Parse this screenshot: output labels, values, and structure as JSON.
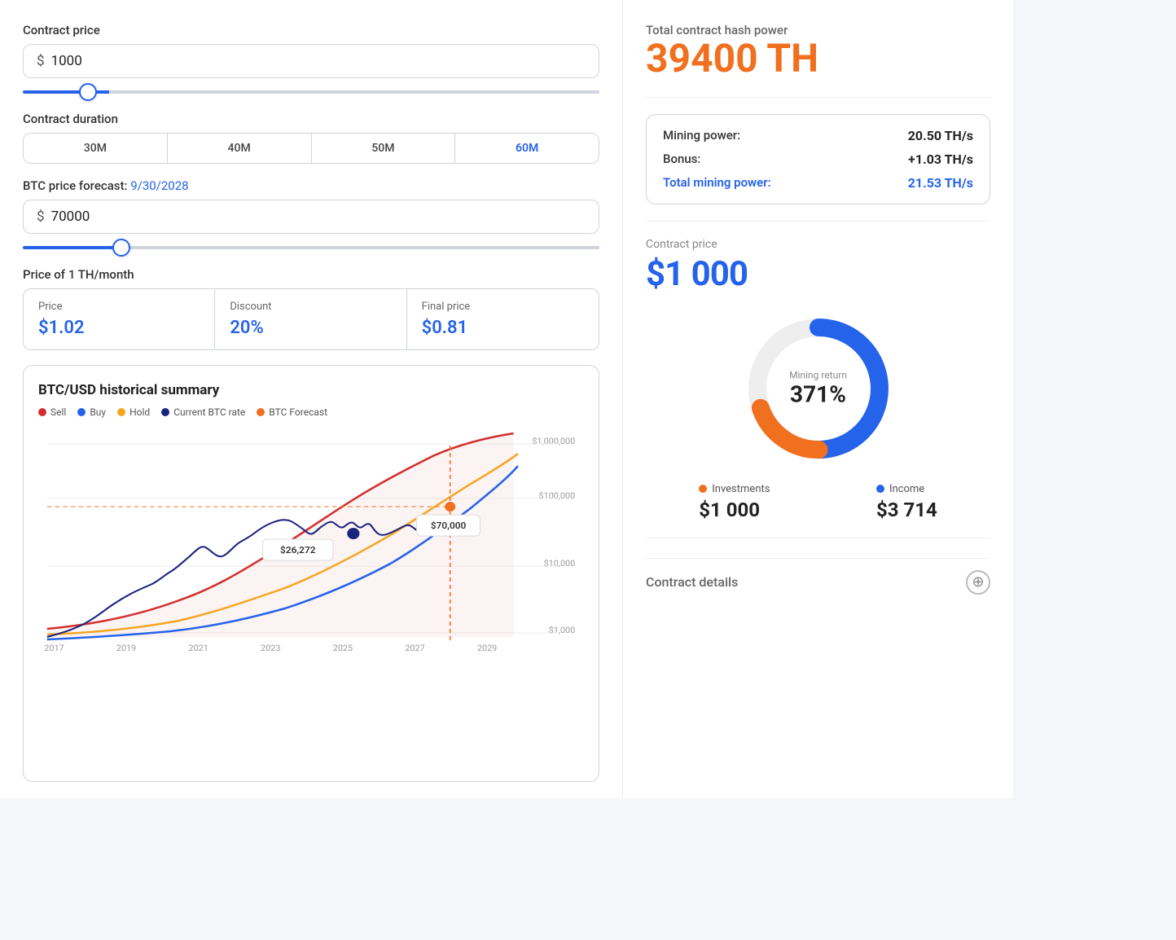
{
  "left": {
    "contract_price_label": "Contract price",
    "contract_price_value": "1000",
    "currency_symbol": "$",
    "slider1_value": 10,
    "contract_duration_label": "Contract duration",
    "duration_tabs": [
      "30M",
      "40M",
      "50M",
      "60M"
    ],
    "active_tab": "60M",
    "forecast_label": "BTC price forecast:",
    "forecast_date": "9/30/2028",
    "btc_price_value": "70000",
    "slider2_value": 16,
    "th_price_label": "Price of 1 TH/month",
    "th_cells": [
      {
        "label": "Price",
        "value": "$1.02"
      },
      {
        "label": "Discount",
        "value": "20%"
      },
      {
        "label": "Final price",
        "value": "$0.81"
      }
    ],
    "chart_title": "BTC/USD historical summary",
    "chart_legend": [
      {
        "color": "#d32f2f",
        "label": "Sell"
      },
      {
        "color": "#2563eb",
        "label": "Buy"
      },
      {
        "color": "#f5a623",
        "label": "Hold"
      },
      {
        "color": "#1a237e",
        "label": "Current BTC rate"
      },
      {
        "color": "#f07020",
        "label": "BTC Forecast"
      }
    ],
    "chart_x_labels": [
      "2017",
      "2019",
      "2021",
      "2023",
      "2025",
      "2027",
      "2029"
    ],
    "chart_y_labels": [
      "$1,000,000",
      "$100,000",
      "$10,000",
      "$1,000"
    ],
    "tooltip1_value": "$26,272",
    "tooltip2_value": "$70,000"
  },
  "right": {
    "total_hash_label": "Total contract hash power",
    "total_hash_value": "39400 TH",
    "mining_rows": [
      {
        "label": "Mining power:",
        "value": "20.50 TH/s",
        "is_total": false
      },
      {
        "label": "Bonus:",
        "value": "+1.03 TH/s",
        "is_total": false
      },
      {
        "label": "Total mining power:",
        "value": "21.53 TH/s",
        "is_total": true
      }
    ],
    "contract_price_section_label": "Contract price",
    "contract_price_display": "$1 000",
    "donut_return_label": "Mining return",
    "donut_return_pct": "371%",
    "investments_label": "Investments",
    "investments_dot_color": "#f07020",
    "investments_value": "$1 000",
    "income_label": "Income",
    "income_dot_color": "#2563eb",
    "income_value": "$3 714",
    "contract_details_label": "Contract details"
  }
}
